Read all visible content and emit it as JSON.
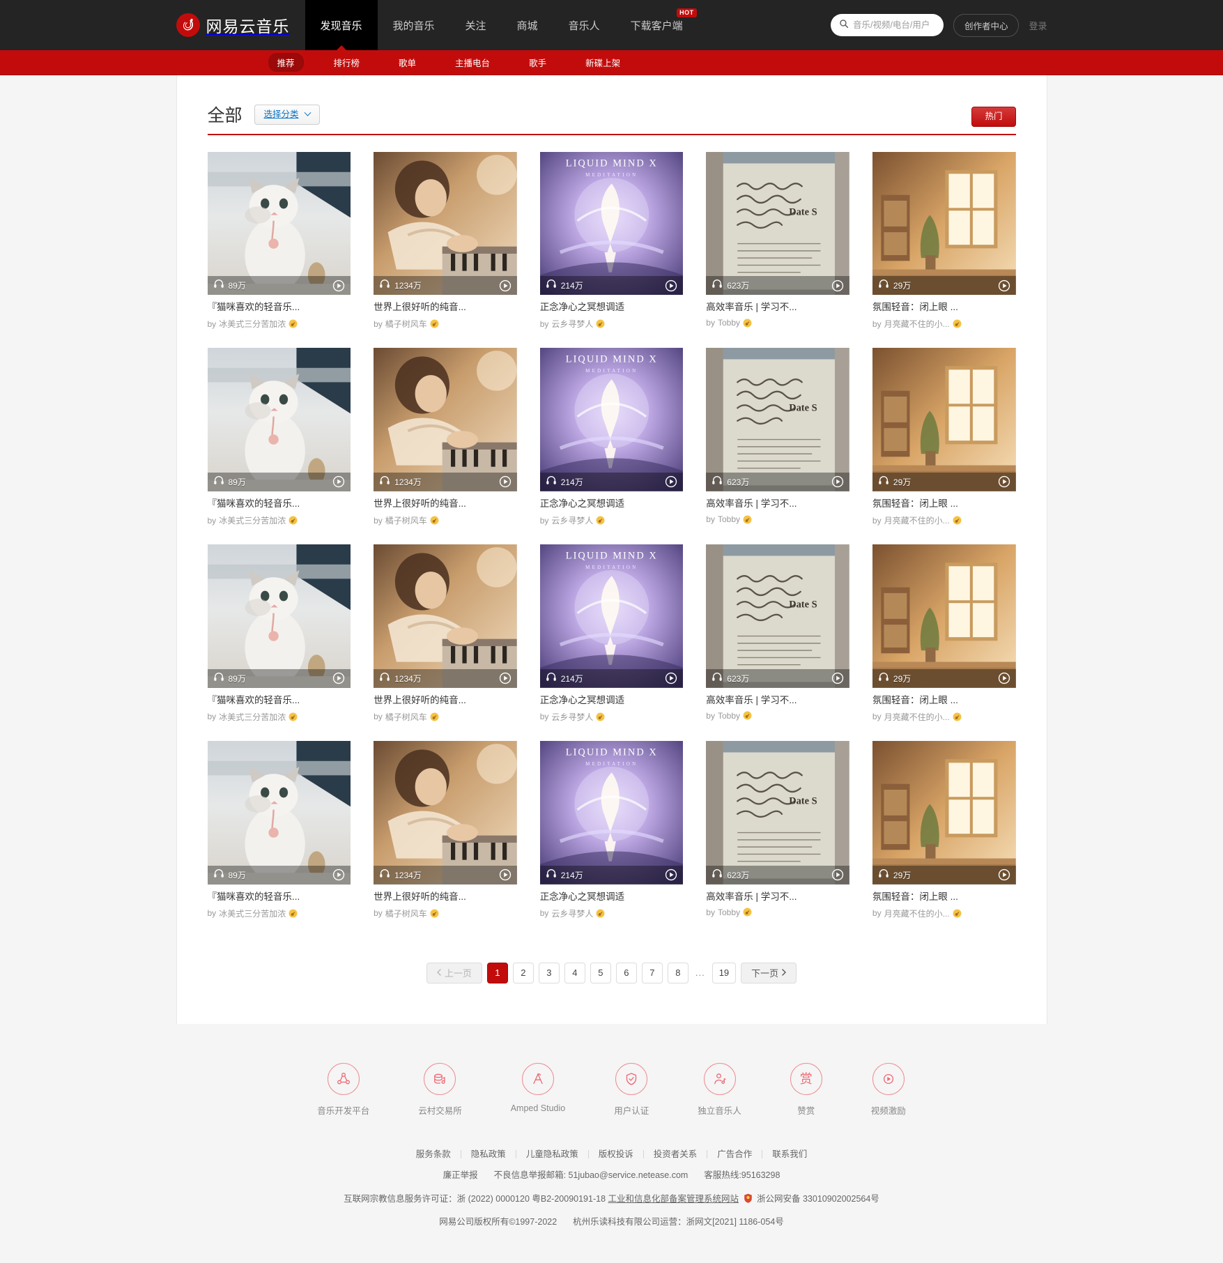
{
  "header": {
    "logo_text": "网易云音乐",
    "logo_icon": "netease-music-logo-icon",
    "nav": [
      {
        "label": "发现音乐",
        "active": true
      },
      {
        "label": "我的音乐",
        "active": false
      },
      {
        "label": "关注",
        "active": false
      },
      {
        "label": "商城",
        "active": false
      },
      {
        "label": "音乐人",
        "active": false
      },
      {
        "label": "下载客户端",
        "active": false,
        "badge": "HOT"
      }
    ],
    "search": {
      "placeholder": "音乐/视频/电台/用户",
      "value": "",
      "icon": "search-icon"
    },
    "creator_button": "创作者中心",
    "login_link": "登录"
  },
  "subnav": [
    {
      "label": "推荐",
      "active": true
    },
    {
      "label": "排行榜",
      "active": false
    },
    {
      "label": "歌单",
      "active": false
    },
    {
      "label": "主播电台",
      "active": false
    },
    {
      "label": "歌手",
      "active": false
    },
    {
      "label": "新碟上架",
      "active": false
    }
  ],
  "filter": {
    "title": "全部",
    "category_select": "选择分类",
    "hot_button": "热门"
  },
  "playlists": [
    {
      "title": "『猫咪喜欢的轻音乐...",
      "by_prefix": "by",
      "author": "冰美式三分苦加浓",
      "play_count": "89万",
      "has_badge": true,
      "cover": "cat-kitten-photo"
    },
    {
      "title": "世界上很好听的纯音...",
      "by_prefix": "by",
      "author": "橘子树风车",
      "play_count": "1234万",
      "has_badge": true,
      "cover": "woman-playing-piano-photo"
    },
    {
      "title": "正念净心之冥想调适",
      "by_prefix": "by",
      "author": "云乡寻梦人",
      "play_count": "214万",
      "has_badge": true,
      "cover": "liquid-mind-album-art"
    },
    {
      "title": "高效率音乐 | 学习不...",
      "by_prefix": "by",
      "author": "Tobby",
      "play_count": "623万",
      "has_badge": true,
      "cover": "handwritten-notebook-photo"
    },
    {
      "title": "氛围轻音：闭上眼 ...",
      "by_prefix": "by",
      "author": "月亮藏不住的小...",
      "play_count": "29万",
      "has_badge": true,
      "cover": "sunlit-room-window-photo"
    }
  ],
  "grid_rows": 4,
  "pagination": {
    "prev": "上一页",
    "next": "下一页",
    "pages": [
      "1",
      "2",
      "3",
      "4",
      "5",
      "6",
      "7",
      "8"
    ],
    "ellipsis": "...",
    "last_page": "19",
    "current": "1"
  },
  "footer": {
    "icons": [
      {
        "label": "音乐开发平台",
        "icon": "music-dev-platform-icon"
      },
      {
        "label": "云村交易所",
        "icon": "cloud-village-exchange-icon"
      },
      {
        "label": "Amped Studio",
        "icon": "amped-studio-icon"
      },
      {
        "label": "用户认证",
        "icon": "user-verify-shield-icon"
      },
      {
        "label": "独立音乐人",
        "icon": "indie-musician-icon"
      },
      {
        "label": "赞赏",
        "icon": "reward-icon"
      },
      {
        "label": "视频激励",
        "icon": "video-incentive-icon"
      }
    ],
    "links": [
      "服务条款",
      "隐私政策",
      "儿童隐私政策",
      "版权投诉",
      "投资者关系",
      "广告合作",
      "联系我们"
    ],
    "report_label": "廉正举报",
    "report_email_label": "不良信息举报邮箱: 51jubao@service.netease.com",
    "hotline": "客服热线:95163298",
    "license_prefix": "互联网宗教信息服务许可证：浙 (2022) 0000120 粤B2-20090191-18",
    "miit_link": "工业和信息化部备案管理系统网站",
    "gongan": "浙公网安备 33010902002564号",
    "copyright": "网易公司版权所有©1997-2022",
    "operator": "杭州乐读科技有限公司运营：浙网文[2021] 1186-054号"
  },
  "colors": {
    "brand_red": "#c20c0c",
    "header_dark": "#242424",
    "link_blue": "#0c73c2"
  }
}
